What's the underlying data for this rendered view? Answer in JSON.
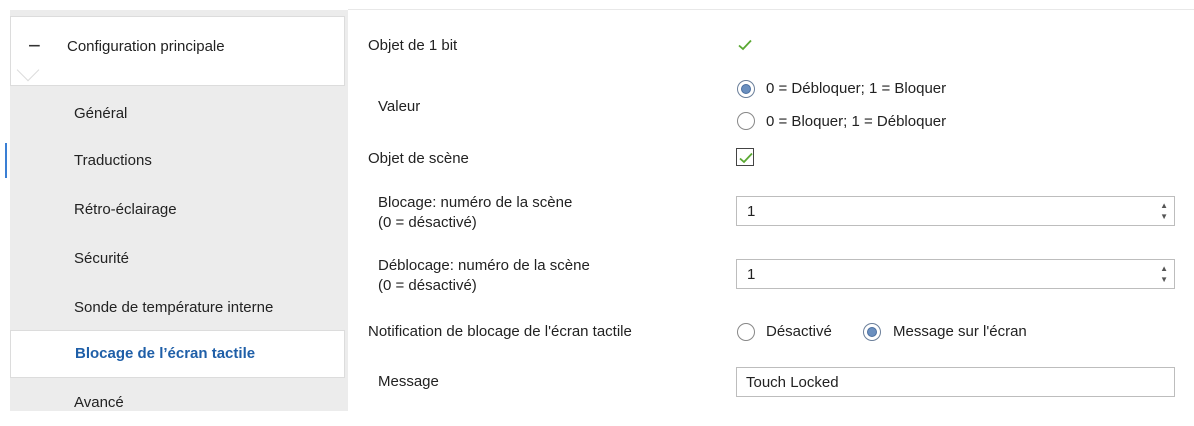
{
  "sidebar": {
    "header": "Configuration principale",
    "collapse_symbol": "−",
    "items": [
      {
        "label": "Général"
      },
      {
        "label": "Traductions"
      },
      {
        "label": "Rétro-éclairage"
      },
      {
        "label": "Sécurité"
      },
      {
        "label": "Sonde de température interne"
      },
      {
        "label": "Blocage de l’écran tactile",
        "active": true
      },
      {
        "label": "Avancé"
      }
    ]
  },
  "form": {
    "obj1bit": {
      "label": "Objet de 1 bit",
      "checked": true
    },
    "valeur": {
      "label": "Valeur",
      "options": [
        "0 = Débloquer; 1 = Bloquer",
        "0 = Bloquer; 1 = Débloquer"
      ],
      "selected": 0
    },
    "objscene": {
      "label": "Objet de scène",
      "checked": true
    },
    "blocage": {
      "label_line1": "Blocage: numéro de la scène",
      "label_line2": "(0 = désactivé)",
      "value": "1"
    },
    "deblocage": {
      "label_line1": "Déblocage: numéro de la scène",
      "label_line2": "(0 = désactivé)",
      "value": "1"
    },
    "notification": {
      "label": "Notification de blocage de l'écran tactile",
      "options": [
        "Désactivé",
        "Message sur l'écran"
      ],
      "selected": 1
    },
    "message": {
      "label": "Message",
      "value": "Touch Locked"
    }
  },
  "colors": {
    "accent": "#1f5fa8",
    "check": "#5aa832",
    "sidebar_bg": "#ececec"
  }
}
